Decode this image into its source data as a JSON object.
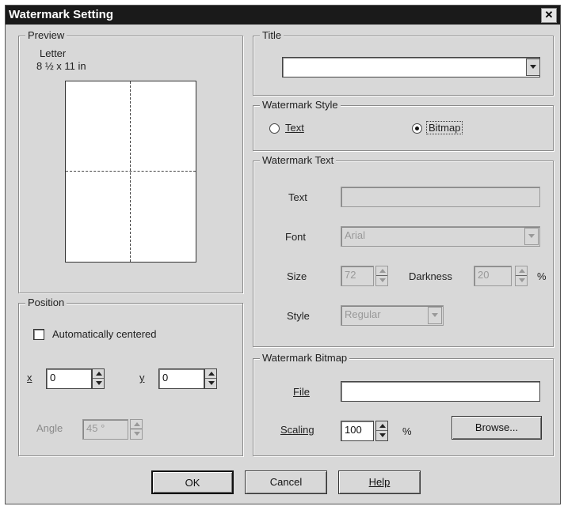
{
  "window": {
    "title": "Watermark Setting",
    "close_glyph": "✕"
  },
  "preview": {
    "group_label": "Preview",
    "paper_name": "Letter",
    "paper_size": "8 ½ x 11 in"
  },
  "title_group": {
    "label": "Title",
    "value": ""
  },
  "watermark_style": {
    "label": "Watermark Style",
    "options": [
      {
        "label": "Text",
        "selected": false
      },
      {
        "label": "Bitmap",
        "selected": true
      }
    ]
  },
  "watermark_text": {
    "label": "Watermark Text",
    "text_label": "Text",
    "text_value": "",
    "font_label": "Font",
    "font_value": "Arial",
    "size_label": "Size",
    "size_value": "72",
    "darkness_label": "Darkness",
    "darkness_value": "20",
    "darkness_unit": "%",
    "style_label": "Style",
    "style_value": "Regular"
  },
  "position": {
    "label": "Position",
    "auto_centered_label": "Automatically centered",
    "auto_centered_checked": false,
    "x_label": "x",
    "x_value": "0",
    "y_label": "y",
    "y_value": "0",
    "angle_label": "Angle",
    "angle_value": "45 °"
  },
  "watermark_bitmap": {
    "label": "Watermark Bitmap",
    "file_label": "File",
    "file_value": "",
    "scaling_label": "Scaling",
    "scaling_value": "100",
    "scaling_unit": "%",
    "browse_label": "Browse..."
  },
  "buttons": {
    "ok": "OK",
    "cancel": "Cancel",
    "help": "Help"
  }
}
